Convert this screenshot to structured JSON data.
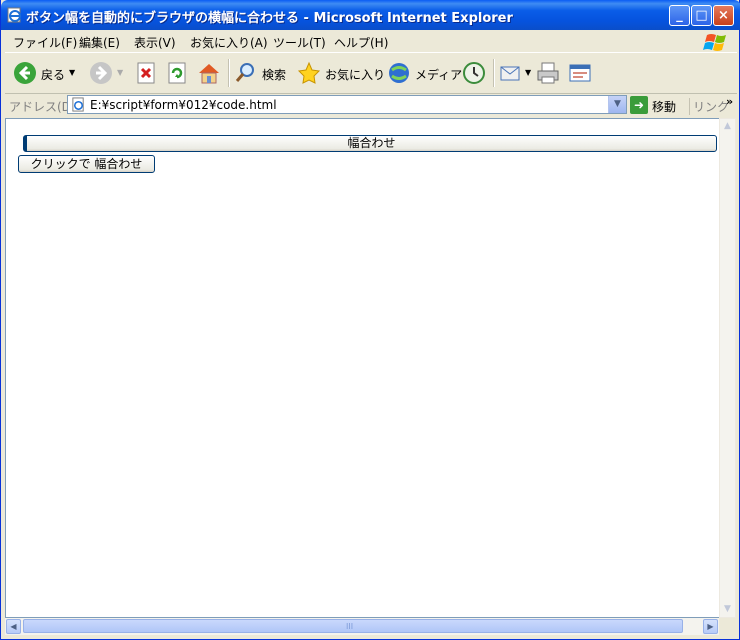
{
  "window": {
    "title": "ボタン幅を自動的にブラウザの横幅に合わせる - Microsoft Internet Explorer",
    "controls": {
      "minimize": "_",
      "maximize": "□",
      "close": "×"
    }
  },
  "menubar": {
    "items": [
      "ファイル(F)",
      "編集(E)",
      "表示(V)",
      "お気に入り(A)",
      "ツール(T)",
      "ヘルプ(H)"
    ]
  },
  "toolbar": {
    "back_label": "戻る",
    "search_label": "検索",
    "favorites_label": "お気に入り",
    "media_label": "メディア"
  },
  "address": {
    "label": "アドレス(D)",
    "value": "E:¥script¥form¥012¥code.html",
    "go_label": "移動",
    "links_label": "リンク",
    "links_chevron": "»"
  },
  "page": {
    "wide_button_label": "幅合わせ",
    "fit_button_label": "クリックで 幅合わせ"
  },
  "scrollbar": {
    "grip": "III"
  },
  "colors": {
    "titlebar": "#0a5de8",
    "chrome": "#ece9d8",
    "button_border": "#003c74"
  }
}
